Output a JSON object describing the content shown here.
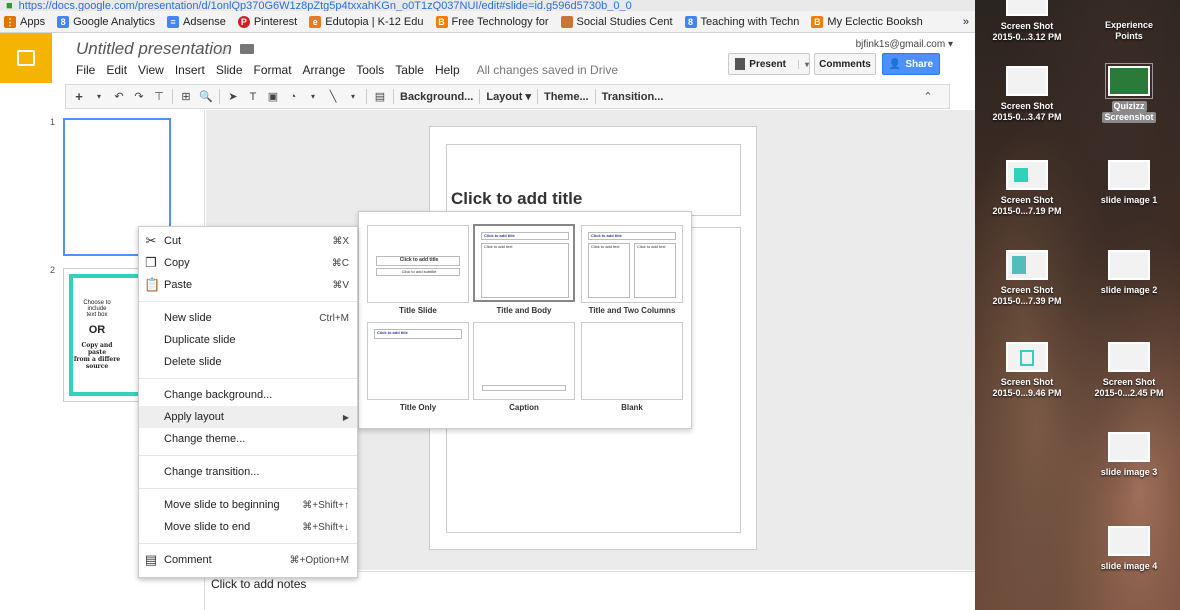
{
  "browser": {
    "url": "https://docs.google.com/presentation/d/1onlQp370G6W1z8pZtg5p4txxahKGn_o0T1zQ037NUI/edit#slide=id.g596d5730b_0_0",
    "bookmarks": [
      {
        "label": "Apps",
        "icon": "apps-grid-icon",
        "color": "#e37400"
      },
      {
        "label": "Google Analytics",
        "icon": "analytics-icon",
        "color": "#4285f4"
      },
      {
        "label": "Adsense",
        "icon": "adsense-icon",
        "color": "#4285f4"
      },
      {
        "label": "Pinterest",
        "icon": "pinterest-icon",
        "color": "#cb2027"
      },
      {
        "label": "Edutopia | K-12 Edu",
        "icon": "edutopia-icon",
        "color": "#e97a1f"
      },
      {
        "label": "Free Technology for",
        "icon": "blogger-icon",
        "color": "#f57d00"
      },
      {
        "label": "Social Studies Cent",
        "icon": "page-icon",
        "color": "#c8743a"
      },
      {
        "label": "Teaching with Techn",
        "icon": "sites-icon",
        "color": "#4285f4"
      },
      {
        "label": "My Eclectic Booksh",
        "icon": "blogger-icon",
        "color": "#f57d00"
      }
    ],
    "more": "»"
  },
  "app": {
    "title": "Untitled presentation",
    "email": "bjfink1s@gmail.com",
    "menus": [
      "File",
      "Edit",
      "View",
      "Insert",
      "Slide",
      "Format",
      "Arrange",
      "Tools",
      "Table",
      "Help"
    ],
    "saved_status": "All changes saved in Drive",
    "present_label": "Present",
    "comments_label": "Comments",
    "share_label": "Share",
    "accent": "#4d90fe",
    "logo_color": "#f4b400"
  },
  "toolbar": {
    "background": "Background...",
    "layout": "Layout",
    "theme": "Theme...",
    "transition": "Transition..."
  },
  "filmstrip": {
    "slide1_num": "1",
    "slide2_num": "2",
    "slide2_line1": "Choose to include",
    "slide2_line2": "text box",
    "slide2_or": "OR",
    "slide2_line3": "Copy and paste",
    "slide2_line4": "from a differe",
    "slide2_line5": "source",
    "border_color": "#2fd3bc"
  },
  "slide": {
    "title_placeholder": "Click to add title",
    "notes_placeholder": "Click to add notes"
  },
  "context_menu": {
    "cut": "Cut",
    "cut_sc": "⌘X",
    "copy": "Copy",
    "copy_sc": "⌘C",
    "paste": "Paste",
    "paste_sc": "⌘V",
    "new_slide": "New slide",
    "new_slide_sc": "Ctrl+M",
    "duplicate": "Duplicate slide",
    "delete": "Delete slide",
    "change_bg": "Change background...",
    "apply_layout": "Apply layout",
    "change_theme": "Change theme...",
    "change_transition": "Change transition...",
    "move_begin": "Move slide to beginning",
    "move_begin_sc": "⌘+Shift+↑",
    "move_end": "Move slide to end",
    "move_end_sc": "⌘+Shift+↓",
    "comment": "Comment",
    "comment_sc": "⌘+Option+M"
  },
  "layouts": {
    "title_slide": "Title Slide",
    "title_body": "Title and Body",
    "title_two_col": "Title and Two Columns",
    "title_only": "Title Only",
    "caption": "Caption",
    "blank": "Blank",
    "mini_title": "Click to add title",
    "mini_subtitle": "Click to add subtitle",
    "mini_text": "Click to add text"
  },
  "desktop": [
    {
      "line1": "Screen Shot",
      "line2": "2015-0...3.12 PM"
    },
    {
      "line1": "Experience",
      "line2": "Points"
    },
    {
      "line1": "Screen Shot",
      "line2": "2015-0...3.47 PM"
    },
    {
      "line1": "Quizizz",
      "line2": "Screenshot"
    },
    {
      "line1": "Screen Shot",
      "line2": "2015-0...7.19 PM"
    },
    {
      "line1": "slide image 1",
      "line2": ""
    },
    {
      "line1": "Screen Shot",
      "line2": "2015-0...7.39 PM"
    },
    {
      "line1": "slide image 2",
      "line2": ""
    },
    {
      "line1": "Screen Shot",
      "line2": "2015-0...9.46 PM"
    },
    {
      "line1": "Screen Shot",
      "line2": "2015-0...2.45 PM"
    },
    {
      "line1": "slide image 3",
      "line2": ""
    },
    {
      "line1": "slide image 4",
      "line2": ""
    }
  ]
}
